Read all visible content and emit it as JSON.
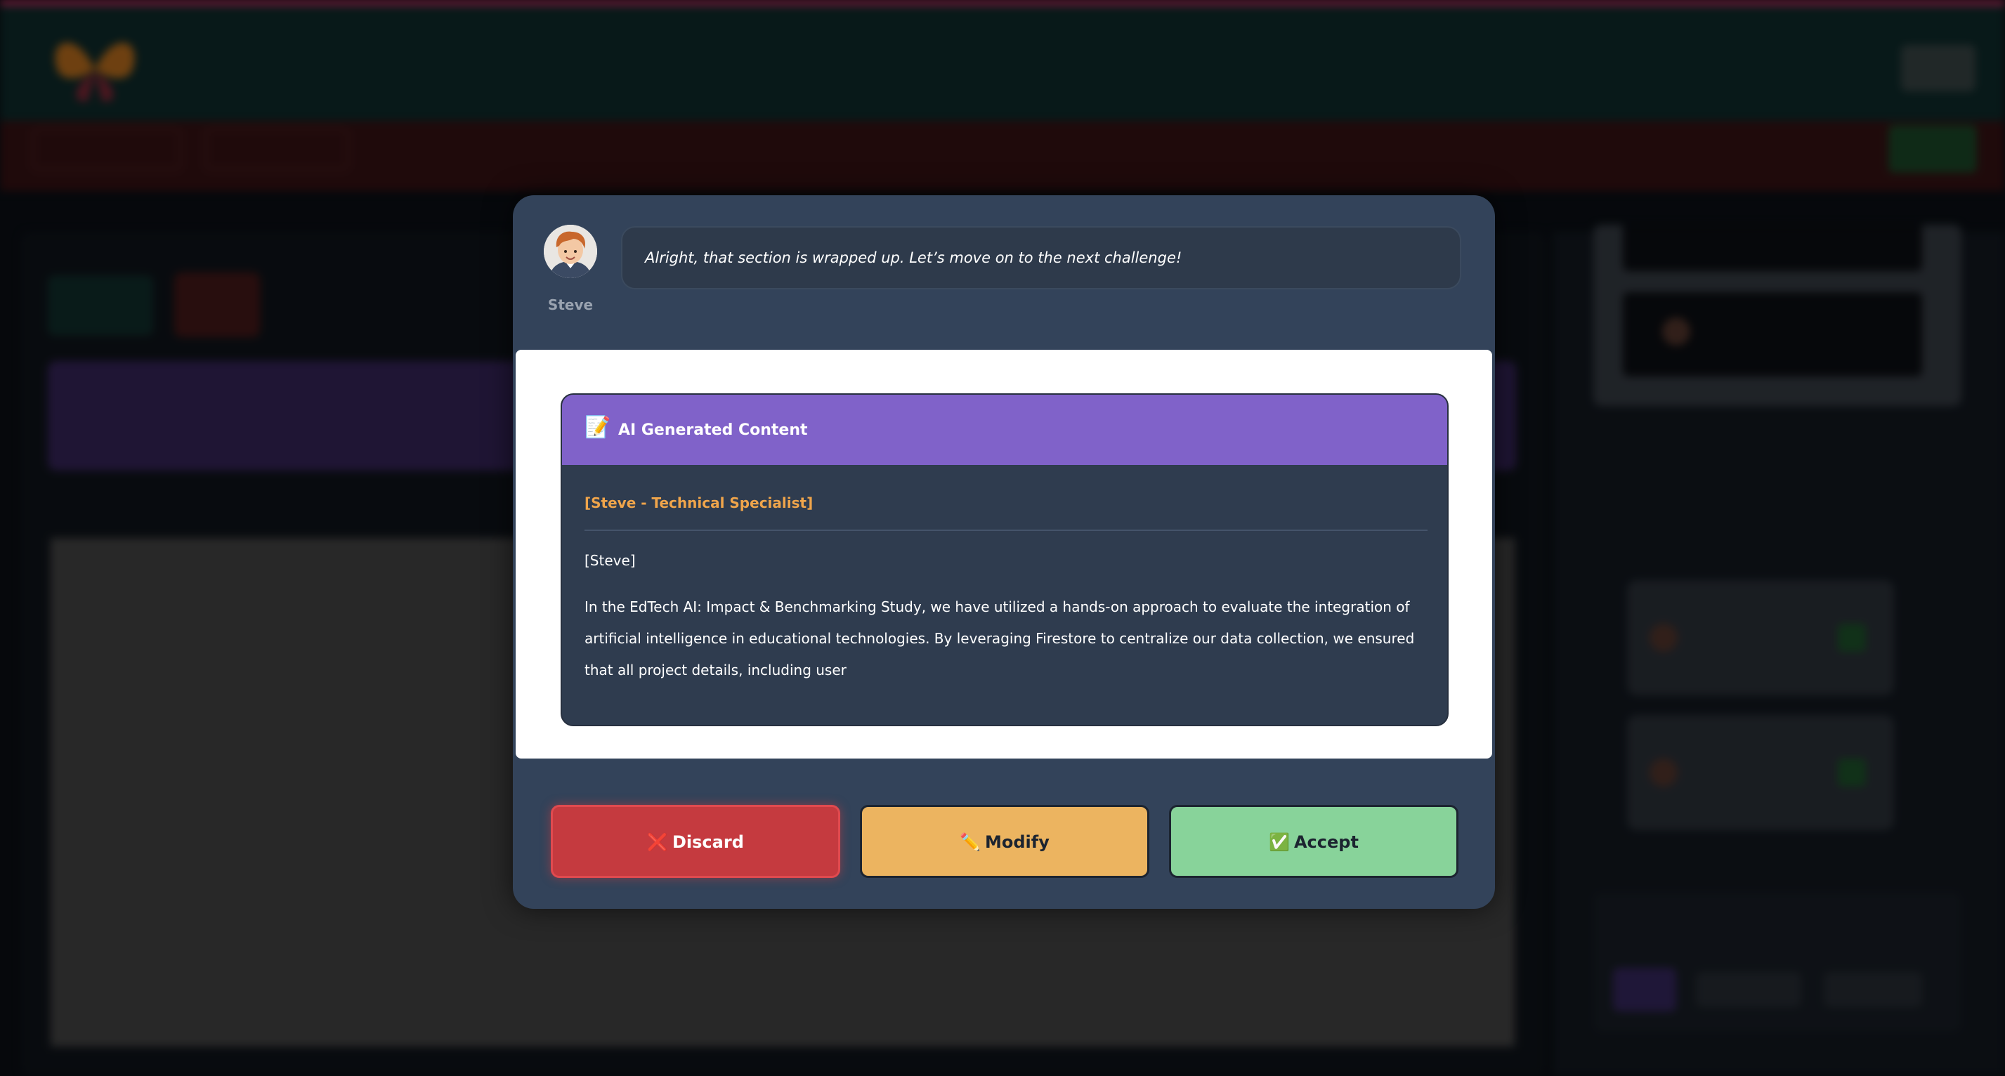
{
  "modal": {
    "assistant_name": "Steve",
    "speech": "Alright, that section is wrapped up. Let’s move on to the next challenge!",
    "content_card": {
      "icon": "memo-icon",
      "title": "AI Generated Content",
      "role_line": "[Steve - Technical Specialist]",
      "speaker_line": "[Steve]",
      "body": "In the EdTech AI: Impact & Benchmarking Study, we have utilized a hands-on approach to evaluate the integration of artificial intelligence in educational technologies. By leveraging Firestore to centralize our data collection, we ensured that all project details, including user"
    },
    "buttons": {
      "discard_icon": "❌",
      "discard_label": "Discard",
      "modify_icon": "✏️",
      "modify_label": "Modify",
      "accept_icon": "✅",
      "accept_label": "Accept"
    }
  },
  "colors": {
    "top_accent": "#d6336c",
    "modal_bg": "#33435a",
    "card_header": "#8062c9",
    "role_text": "#f0a54b",
    "discard": "#c53a3f",
    "modify": "#ecb460",
    "accept": "#88d39a"
  }
}
